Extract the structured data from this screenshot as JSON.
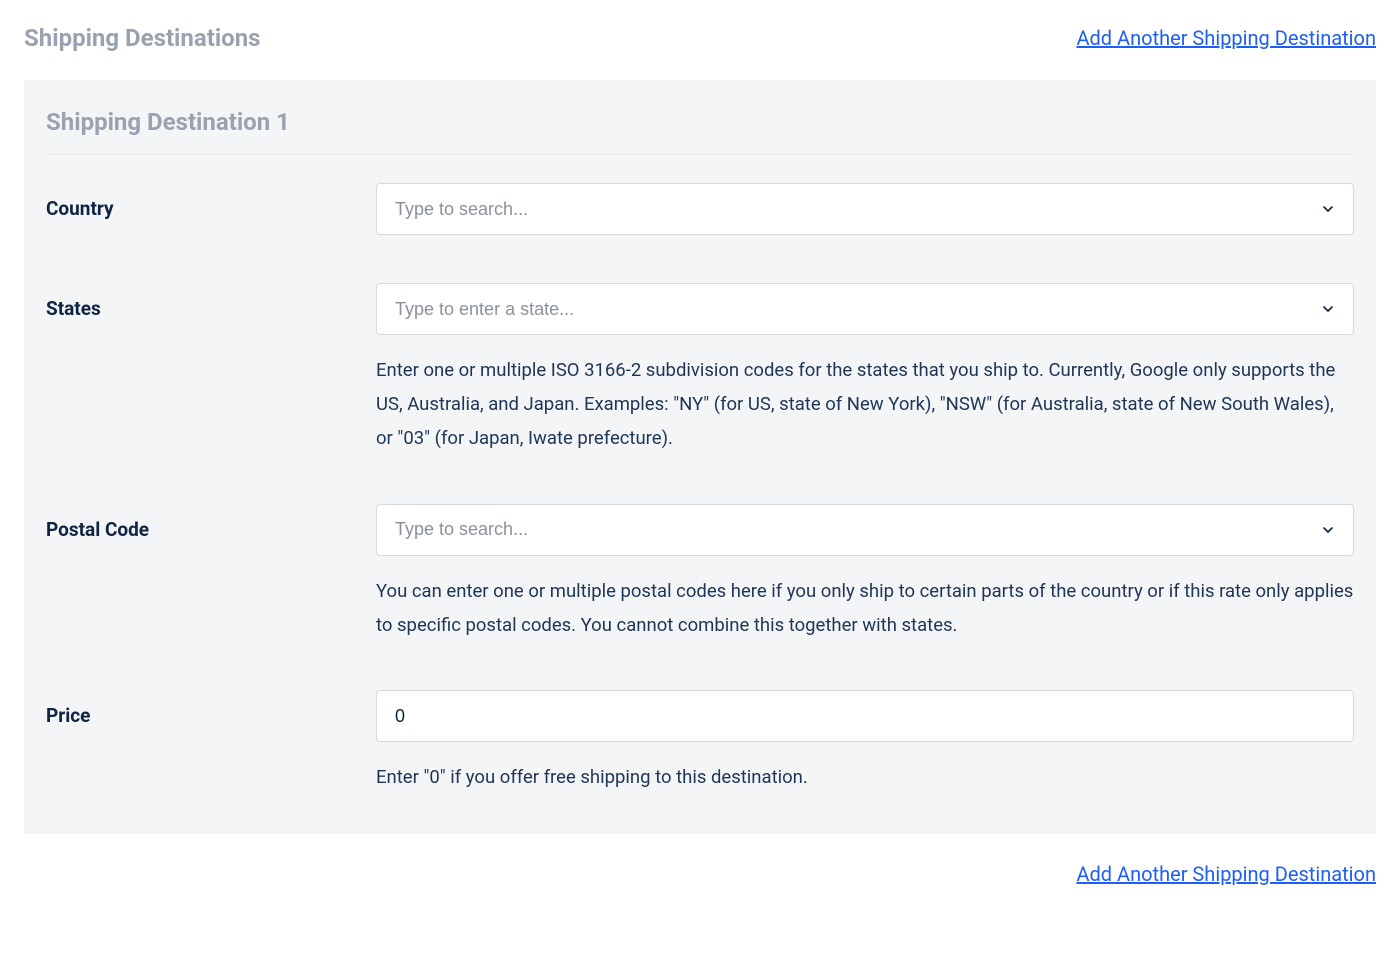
{
  "header": {
    "title": "Shipping Destinations",
    "add_link": "Add Another Shipping Destination"
  },
  "panel": {
    "title": "Shipping Destination 1"
  },
  "fields": {
    "country": {
      "label": "Country",
      "placeholder": "Type to search..."
    },
    "states": {
      "label": "States",
      "placeholder": "Type to enter a state...",
      "help": "Enter one or multiple ISO 3166-2 subdivision codes for the states that you ship to. Currently, Google only supports the US, Australia, and Japan. Examples: \"NY\" (for US, state of New York), \"NSW\" (for Australia, state of New South Wales), or \"03\" (for Japan, Iwate prefecture)."
    },
    "postal_code": {
      "label": "Postal Code",
      "placeholder": "Type to search...",
      "help": "You can enter one or multiple postal codes here if you only ship to certain parts of the country or if this rate only applies to specific postal codes. You cannot combine this together with states."
    },
    "price": {
      "label": "Price",
      "value": "0",
      "help": "Enter \"0\" if you offer free shipping to this destination."
    }
  },
  "footer": {
    "add_link": "Add Another Shipping Destination"
  }
}
